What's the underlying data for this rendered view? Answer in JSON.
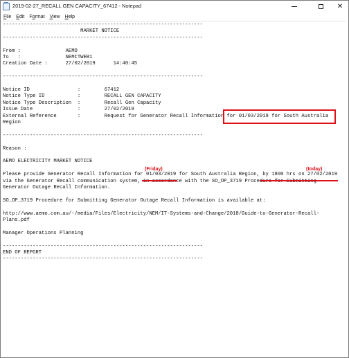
{
  "window": {
    "title": "2019-02-27_RECALL GEN CAPACITY_67412 - Notepad",
    "minimize_glyph": "minimize-icon",
    "maximize_glyph": "maximize-icon",
    "close_glyph": "✕"
  },
  "menu": {
    "items": [
      {
        "accel": "F",
        "rest": "ile"
      },
      {
        "accel": "E",
        "rest": "dit"
      },
      {
        "pre": "F",
        "accel": "o",
        "rest": "rmat"
      },
      {
        "accel": "V",
        "rest": "iew"
      },
      {
        "accel": "H",
        "rest": "elp"
      }
    ]
  },
  "document": {
    "lines": [
      "-------------------------------------------------------------------",
      "                          MARKET NOTICE",
      "-------------------------------------------------------------------",
      "",
      "From :               AEMO",
      "To   :               NEMITWEB1",
      "Creation Date :      27/02/2019      14:40:45",
      "",
      "-------------------------------------------------------------------",
      "",
      "Notice ID                :        67412",
      "Notice Type ID           :        RECALL GEN CAPACITY",
      "Notice Type Description  :        Recall Gen Capacity",
      "Issue Date               :        27/02/2019",
      "External Reference       :        Request for Generator Recall Information for 01/03/2019 for South Australia",
      "Region",
      "",
      "-------------------------------------------------------------------",
      "",
      "Reason :",
      "",
      "AEMO ELECTRICITY MARKET NOTICE",
      "",
      "Please provide Generator Recall Information for 01/03/2019 for South Australia Region, by 1800 hrs on 27/02/2019",
      "via the Generator Recall communication system, in accordance with the SO_OP_3719 Procedure for Submitting",
      "Generator Outage Recall Information.",
      "",
      "SO_OP_3719 Procedure for Submitting Generator Outage Recall Information is available at:",
      "",
      "http://www.aemo.com.au/-/media/Files/Electricity/NEM/IT-Systems-and-Change/2018/Guide-to-Generator-Recall-",
      "Plans.pdf",
      "",
      "Manager Operations Planning",
      "",
      "-------------------------------------------------------------------",
      "END OF REPORT",
      "-------------------------------------------------------------------"
    ]
  },
  "annotations": {
    "friday": "(Friday)",
    "today": "(today)",
    "color": "#e0101a"
  }
}
